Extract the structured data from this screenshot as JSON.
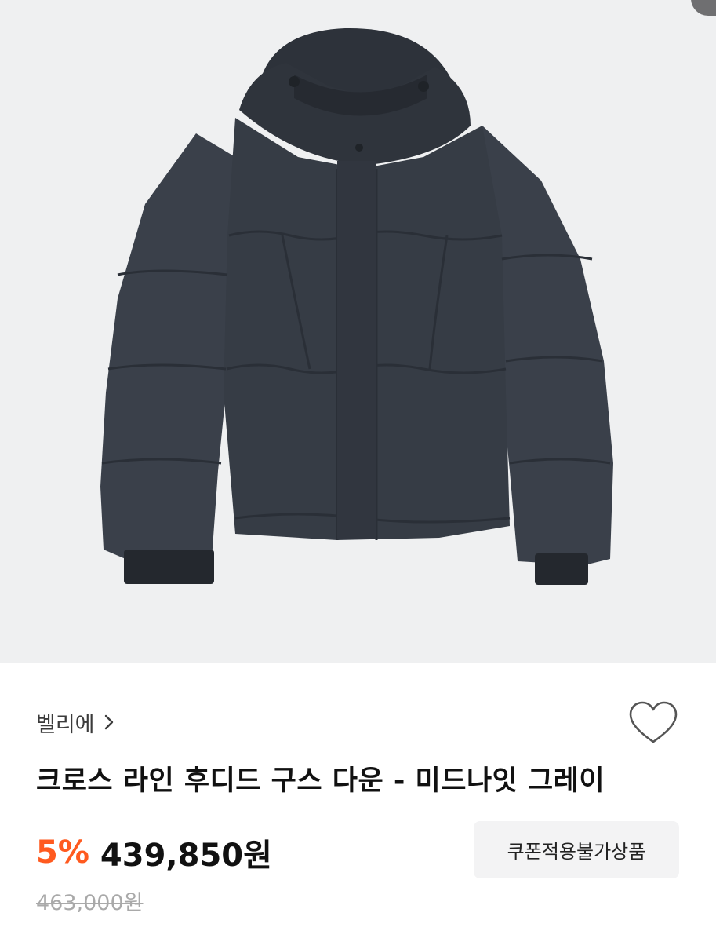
{
  "brand": {
    "name": "벨리에"
  },
  "product": {
    "title": "크로스 라인 후디드 구스 다운 - 미드나잇 그레이",
    "discount_rate": "5%",
    "price": "439,850원",
    "original_price": "463,000원",
    "coupon_label": "쿠폰적용불가상품"
  },
  "colors": {
    "discount": "#ff5a1f",
    "image_background": "#eff0f1",
    "jacket": "#363c45",
    "coupon_background": "#f3f3f4"
  },
  "icons": [
    "chevron-right-icon",
    "heart-outline-icon"
  ]
}
